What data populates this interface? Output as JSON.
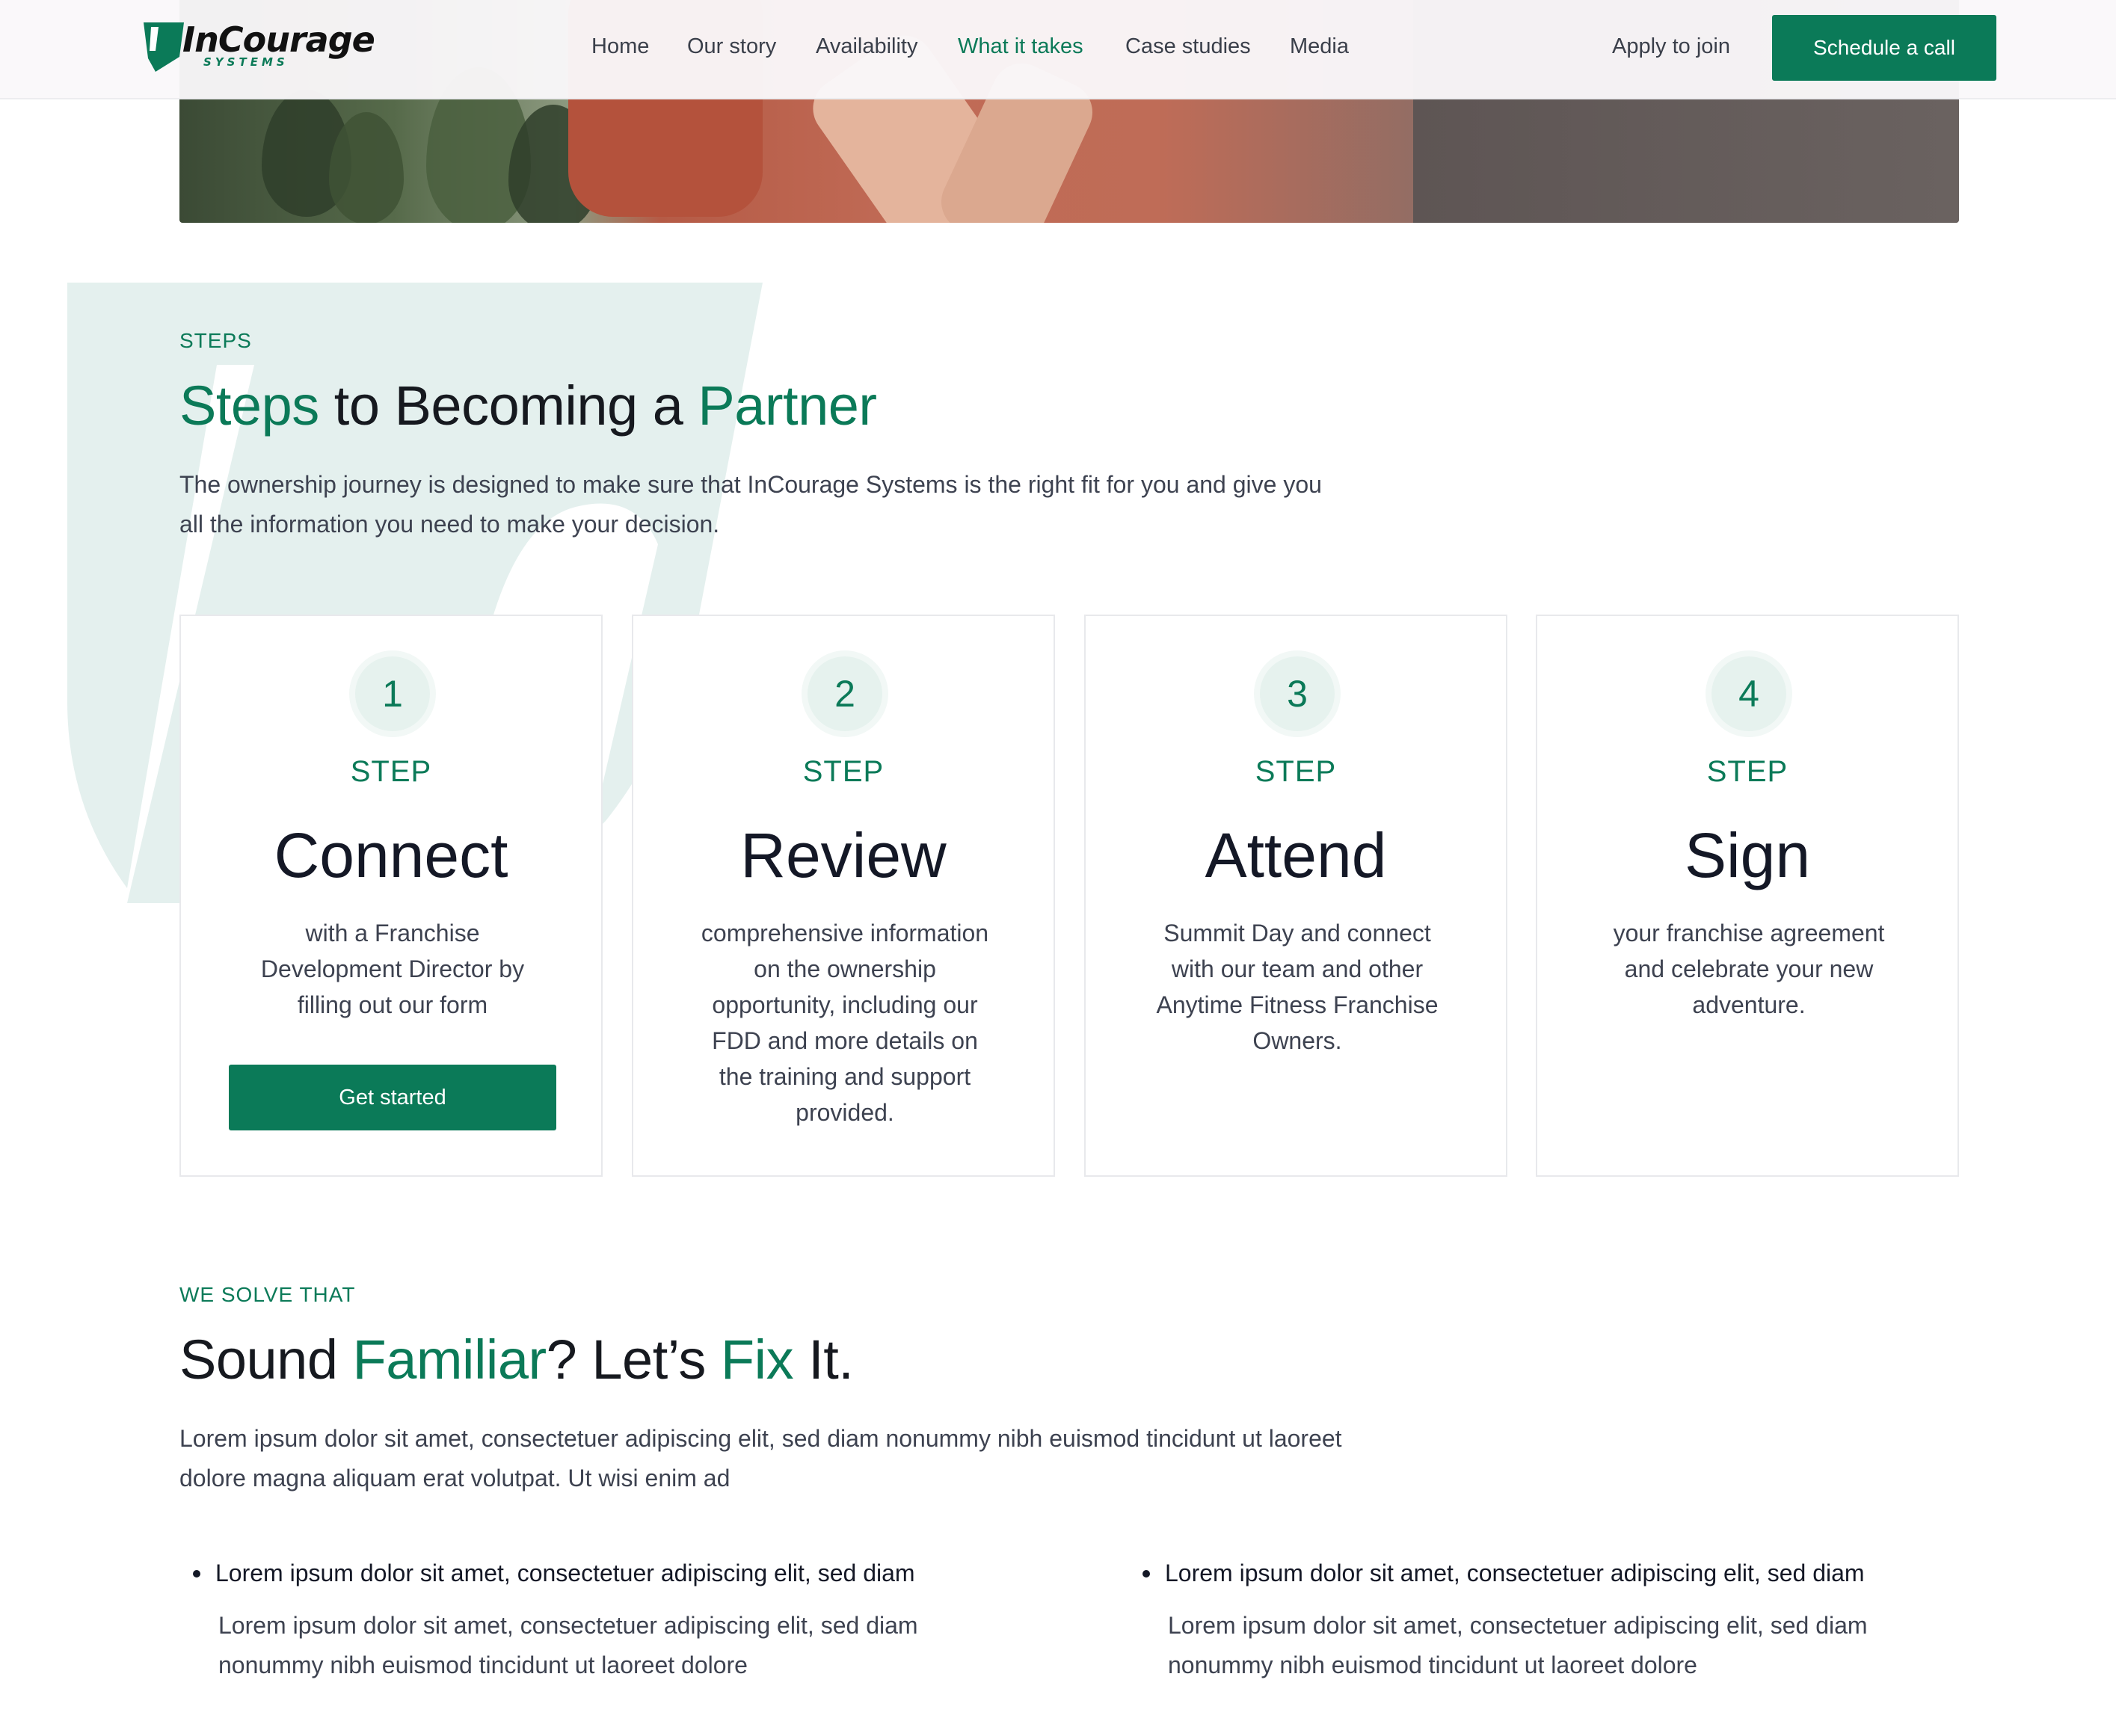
{
  "header": {
    "logo": {
      "wordmark": "InCourage",
      "sub": "SYSTEMS"
    },
    "nav": [
      {
        "label": "Home",
        "active": false
      },
      {
        "label": "Our story",
        "active": false
      },
      {
        "label": "Availability",
        "active": false
      },
      {
        "label": "What it takes",
        "active": true
      },
      {
        "label": "Case studies",
        "active": false
      },
      {
        "label": "Media",
        "active": false
      }
    ],
    "apply_label": "Apply to join",
    "cta_label": "Schedule a call"
  },
  "steps_section": {
    "eyebrow": "STEPS",
    "title_parts": [
      "Steps",
      " to Becoming a ",
      "Partner"
    ],
    "lead": "The ownership journey is designed to make sure that InCourage Systems is the right fit for you and give you all the information you need to make your decision.",
    "cards": [
      {
        "number": "1",
        "label": "STEP",
        "title": "Connect",
        "desc": "with a Franchise Development Director by filling out our form",
        "button": "Get started"
      },
      {
        "number": "2",
        "label": "STEP",
        "title": "Review",
        "desc": "comprehensive information on the ownership opportunity, including our FDD and more details on the training and support provided."
      },
      {
        "number": "3",
        "label": "STEP",
        "title": "Attend",
        "desc": "Summit Day and connect with our team and other Anytime Fitness Franchise Owners."
      },
      {
        "number": "4",
        "label": "STEP",
        "title": "Sign",
        "desc": "your franchise agreement and celebrate your new adventure."
      }
    ]
  },
  "solve_section": {
    "eyebrow": "WE SOLVE THAT",
    "title_parts": [
      "Sound ",
      "Familiar",
      "? Let’s ",
      "Fix",
      " It."
    ],
    "lead": "Lorem ipsum dolor sit amet, consectetuer adipiscing elit, sed diam nonummy nibh euismod tincidunt ut laoreet dolore magna aliquam erat volutpat. Ut wisi enim ad",
    "bullets": [
      {
        "heading": "Lorem ipsum dolor sit amet, consectetuer adipiscing elit, sed diam",
        "body": "Lorem ipsum dolor sit amet, consectetuer adipiscing elit, sed diam nonummy nibh euismod tincidunt ut laoreet dolore"
      },
      {
        "heading": "Lorem ipsum dolor sit amet, consectetuer adipiscing elit, sed diam",
        "body": "Lorem ipsum dolor sit amet, consectetuer adipiscing elit, sed diam nonummy nibh euismod tincidunt ut laoreet dolore"
      }
    ]
  },
  "colors": {
    "brand_green": "#0b7a58",
    "card_border": "#e8e9ec",
    "bg_shape": "#e4f0ee"
  }
}
